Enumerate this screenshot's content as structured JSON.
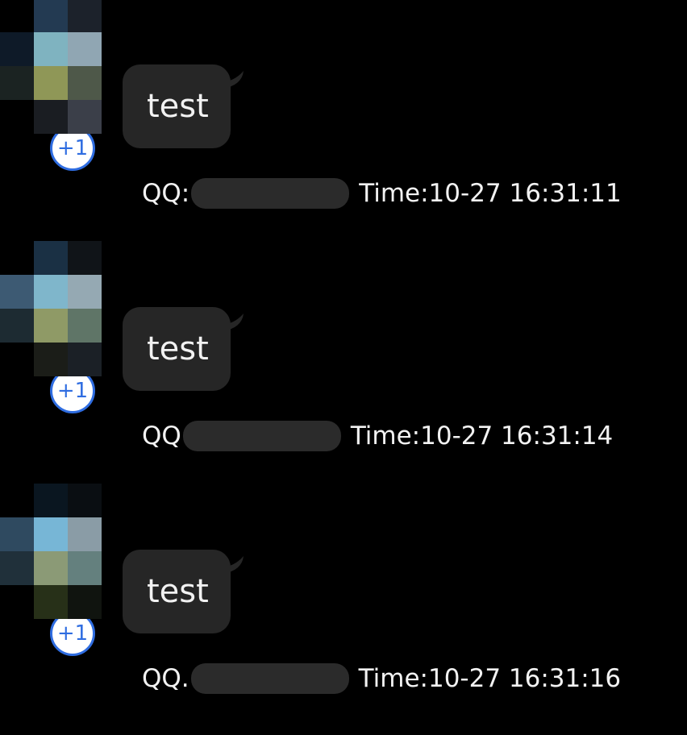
{
  "messages": [
    {
      "avatar_label": "user avatar (pixelated)",
      "badge": "+1",
      "text": "test",
      "qq_label": "QQ:",
      "time": "Time:10-27 16:31:11",
      "avatar_pixels": [
        "#07101a",
        "#233a52",
        "#1c222b",
        "#0e1a28",
        "#7fb3c0",
        "#90a6b3",
        "#1b2322",
        "#8f9757",
        "#4e5849",
        "#000000",
        "#1a1d22",
        "#3b3f49"
      ]
    },
    {
      "avatar_label": "user avatar (pixelated)",
      "badge": "+1",
      "text": "test",
      "qq_label": "QQ",
      "time": "Time:10-27 16:31:14",
      "avatar_pixels": [
        "#000000",
        "#1a3044",
        "#101418",
        "#3d5a73",
        "#7fb6cb",
        "#95a9b3",
        "#1d2b32",
        "#8f9a66",
        "#5f7567",
        "#000000",
        "#1b1d18",
        "#1b2026"
      ]
    },
    {
      "avatar_label": "user avatar (pixelated)",
      "badge": "+1",
      "text": "test",
      "qq_label": "QQ.",
      "time": "Time:10-27 16:31:16",
      "avatar_pixels": [
        "#000000",
        "#0a1620",
        "#0a0e12",
        "#2f4a60",
        "#77b6d6",
        "#8a9ca6",
        "#20303a",
        "#8b9a76",
        "#64807e",
        "#000000",
        "#273018",
        "#10140f"
      ]
    }
  ],
  "colors": {
    "background": "#000000",
    "bubble": "#262626",
    "text": "#f2f2f2",
    "badge_border": "#2f6de1",
    "redaction": "#2b2b2b"
  }
}
